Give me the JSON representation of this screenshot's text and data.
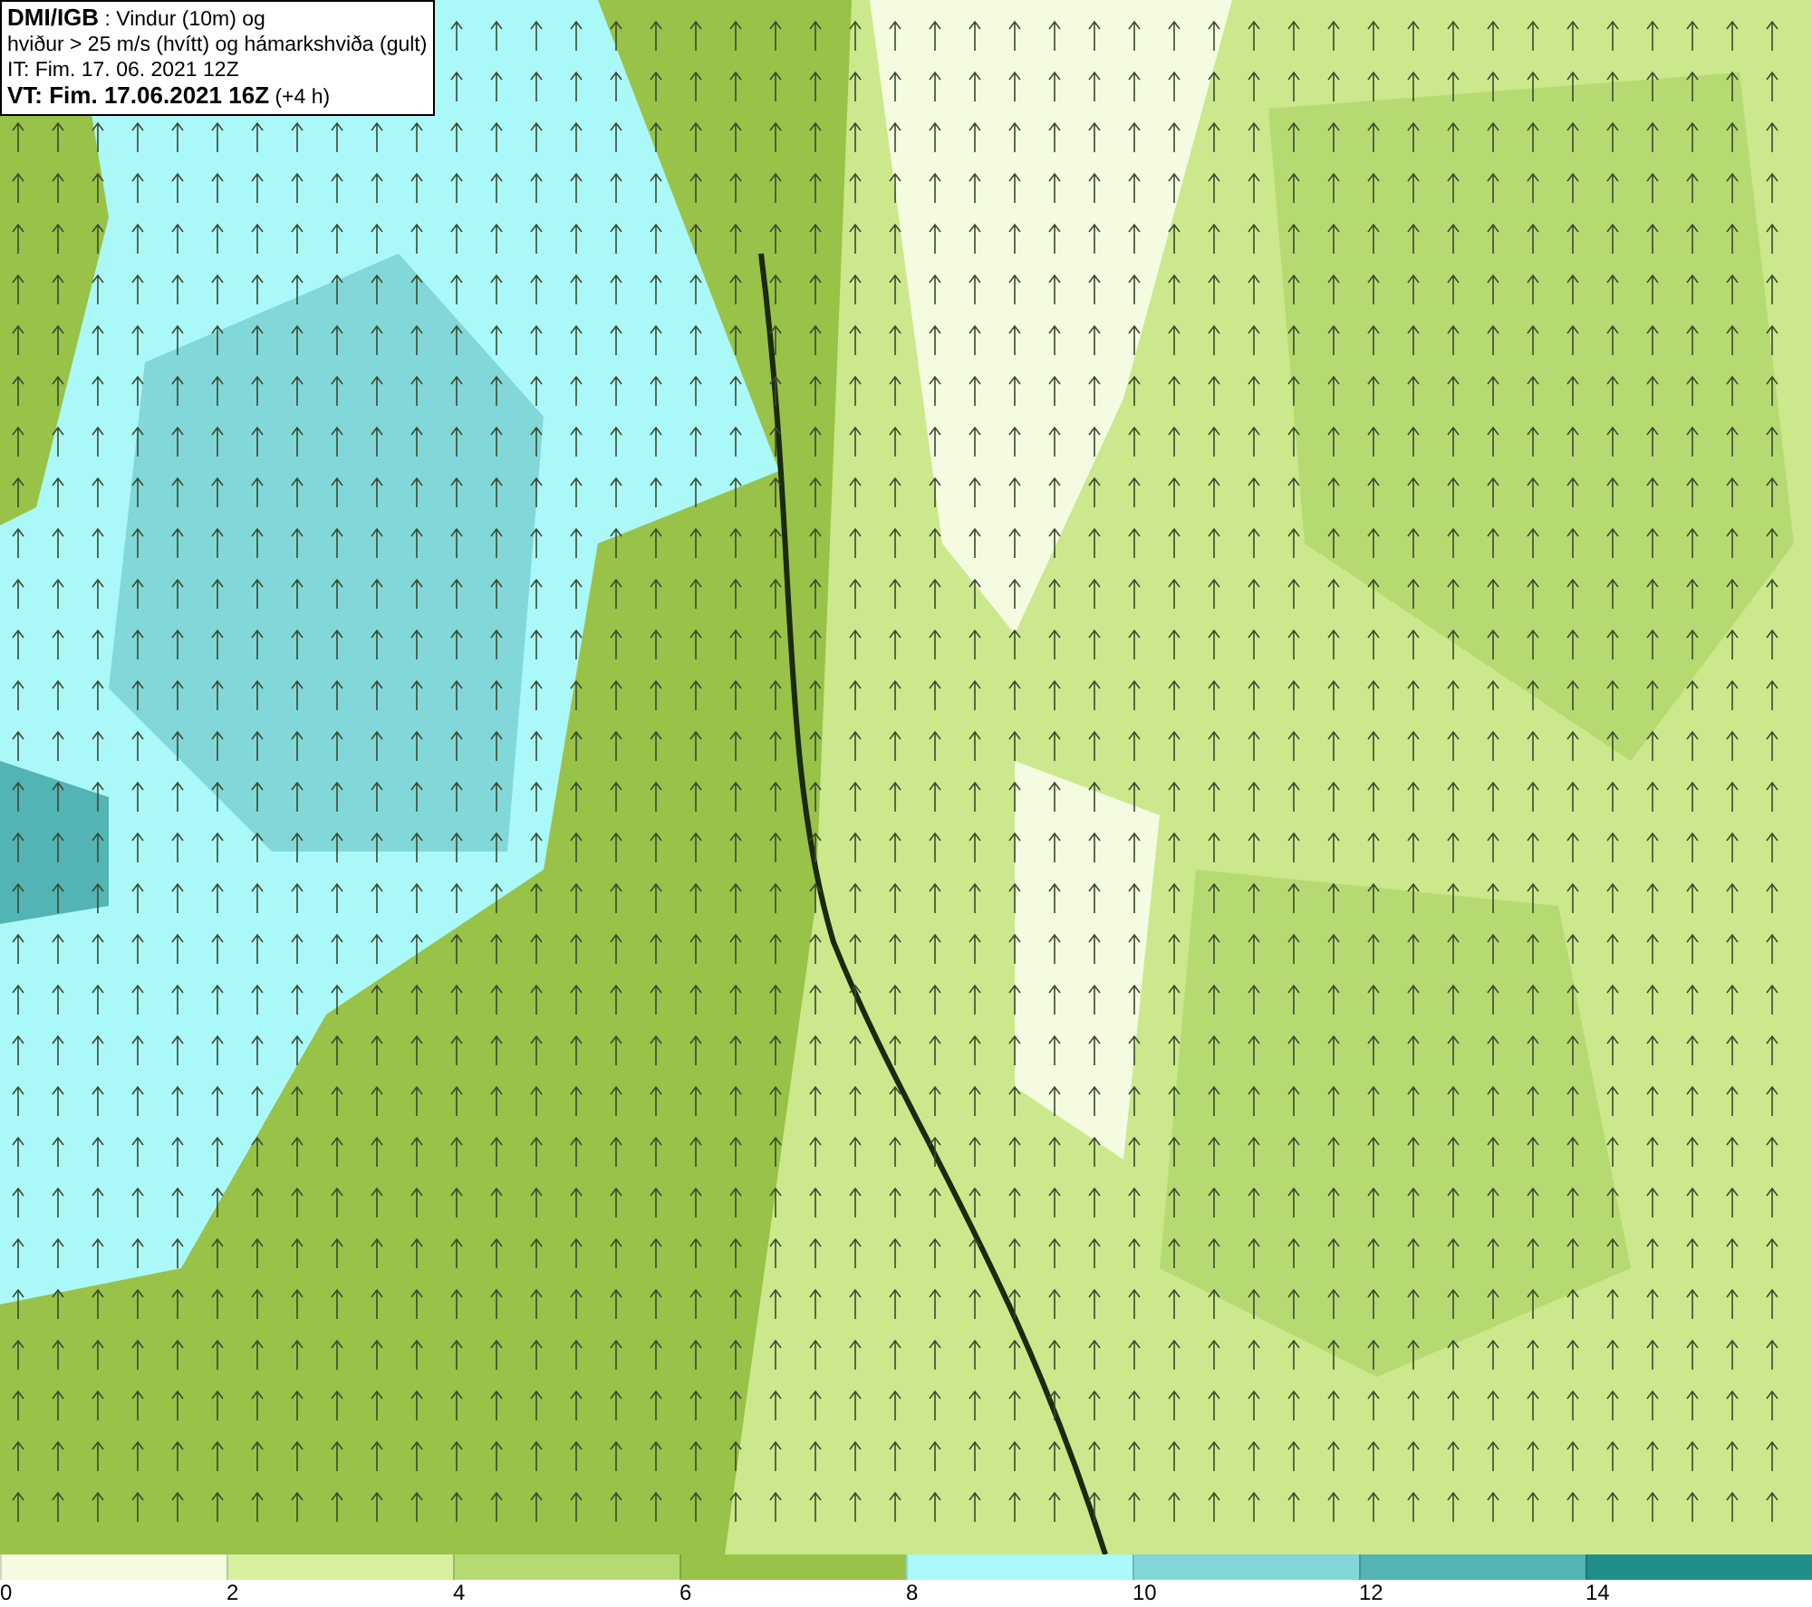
{
  "info_box": {
    "lines": [
      "**DMI/IGB** : Vindur (10m) og",
      "hviður > 25 m/s (hvítt) og hámarkshviða (gult)",
      "IT: Fim. 17. 06. 2021 12Z",
      "**VT: Fim. 17.06.2021 16Z** (+4 h)"
    ]
  },
  "legend": [
    {
      "label": "0",
      "color": "#f4fbe0"
    },
    {
      "label": "2",
      "color": "#d6f0a0"
    },
    {
      "label": "4",
      "color": "#b6da72"
    },
    {
      "label": "6",
      "color": "#98c248"
    },
    {
      "label": "8",
      "color": "#aaf8f8"
    },
    {
      "label": "10",
      "color": "#82d8d8"
    },
    {
      "label": "12",
      "color": "#52b4b4"
    },
    {
      "label": "14",
      "color": "#228e8a"
    }
  ]
}
